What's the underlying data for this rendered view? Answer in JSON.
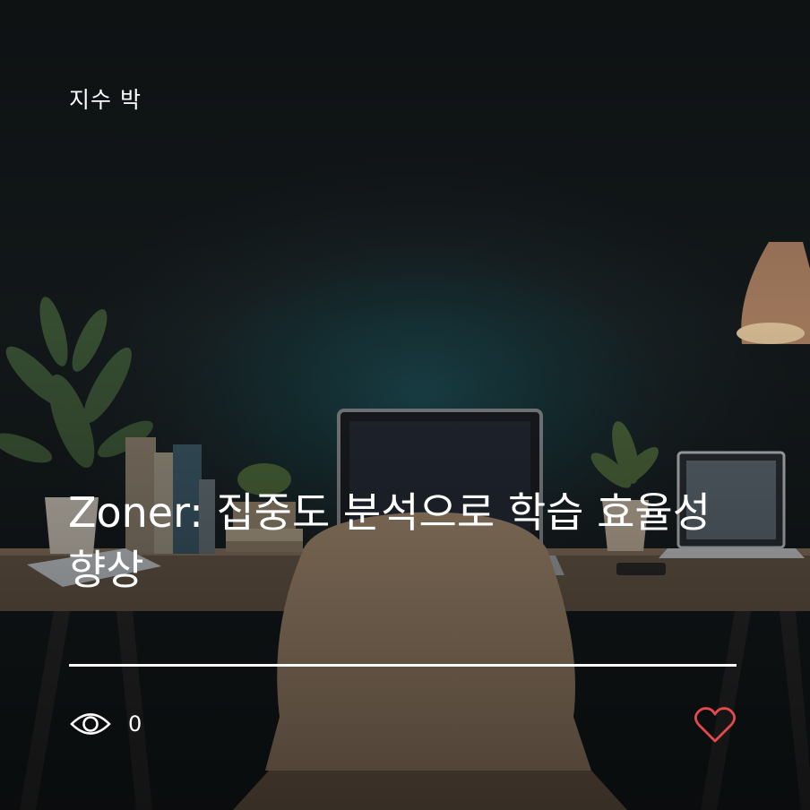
{
  "post": {
    "author": "지수 박",
    "title": "Zoner: 집중도 분석으로 학습 효율성 향상",
    "view_count": "0"
  },
  "icons": {
    "views": "eye-icon",
    "like": "heart-icon"
  },
  "colors": {
    "text": "#ffffff",
    "like": "#e5484d"
  }
}
